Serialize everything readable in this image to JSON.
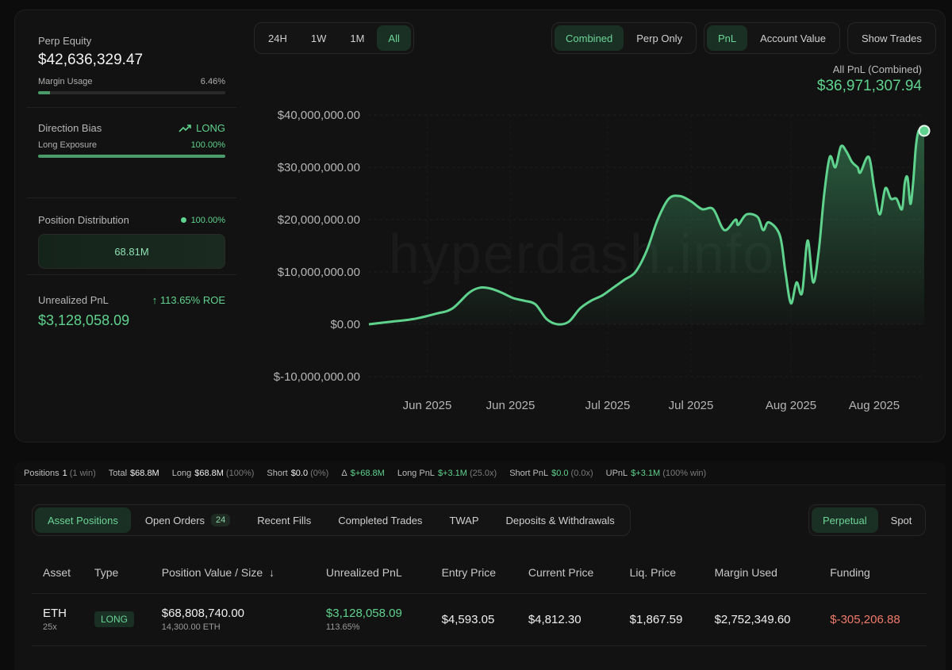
{
  "watermark": "hyperdash.info",
  "left": {
    "perp_equity_label": "Perp Equity",
    "perp_equity_value": "$42,636,329.47",
    "margin_usage_label": "Margin Usage",
    "margin_usage_value": "6.46%",
    "margin_usage_fraction": 0.0646,
    "direction_bias_label": "Direction Bias",
    "direction_bias_value": "LONG",
    "long_exposure_label": "Long Exposure",
    "long_exposure_value": "100.00%",
    "long_exposure_fraction": 1.0,
    "position_distribution_label": "Position Distribution",
    "position_distribution_value": "100.00%",
    "position_distribution_amount": "68.81M",
    "unrealized_pnl_label": "Unrealized PnL",
    "unrealized_pnl_roe": "113.65% ROE",
    "unrealized_pnl_value": "$3,128,058.09"
  },
  "timeframes": [
    "24H",
    "1W",
    "1M",
    "All"
  ],
  "timeframe_active": "All",
  "modes": [
    "Combined",
    "Perp Only"
  ],
  "mode_active": "Combined",
  "metrics": [
    "PnL",
    "Account Value"
  ],
  "metric_active": "PnL",
  "show_trades_label": "Show Trades",
  "pnl_header_label": "All PnL (Combined)",
  "pnl_header_value": "$36,971,307.94",
  "chart_data": {
    "type": "area",
    "ylim": [
      -10000000,
      40000000
    ],
    "y_ticks": [
      40000000,
      30000000,
      20000000,
      10000000,
      0,
      -10000000
    ],
    "y_tick_labels": [
      "$40,000,000.00",
      "$30,000,000.00",
      "$20,000,000.00",
      "$10,000,000.00",
      "$0.00",
      "$-10,000,000.00"
    ],
    "x_tick_labels": [
      "Jun 2025",
      "Jun 2025",
      "Jul 2025",
      "Jul 2025",
      "Aug 2025",
      "Aug 2025"
    ],
    "x_tick_positions": [
      0.105,
      0.255,
      0.43,
      0.58,
      0.76,
      0.91
    ],
    "series": [
      {
        "x": [
          0,
          0.04,
          0.08,
          0.12,
          0.15,
          0.18,
          0.2,
          0.22,
          0.24,
          0.26,
          0.28,
          0.3,
          0.32,
          0.34,
          0.36,
          0.38,
          0.4,
          0.42,
          0.44,
          0.46,
          0.48,
          0.5,
          0.52,
          0.54,
          0.56,
          0.58,
          0.6,
          0.62,
          0.64,
          0.66,
          0.665,
          0.68,
          0.7,
          0.71,
          0.72,
          0.74,
          0.75,
          0.76,
          0.77,
          0.78,
          0.79,
          0.8,
          0.81,
          0.82,
          0.83,
          0.84,
          0.85,
          0.86,
          0.87,
          0.88,
          0.885,
          0.9,
          0.91,
          0.92,
          0.93,
          0.94,
          0.95,
          0.96,
          0.965,
          0.97,
          0.975,
          0.98,
          0.985,
          0.99,
          0.995,
          1.0
        ],
        "y": [
          0,
          500000,
          1000000,
          2000000,
          3000000,
          6000000,
          7000000,
          6800000,
          6000000,
          5000000,
          4500000,
          3800000,
          1000000,
          0,
          500000,
          3000000,
          4500000,
          5500000,
          7000000,
          8500000,
          10000000,
          14000000,
          20000000,
          24000000,
          24500000,
          23500000,
          22000000,
          22000000,
          18000000,
          20000000,
          19000000,
          21000000,
          20500000,
          18000000,
          19500000,
          17000000,
          10000000,
          4000000,
          8000000,
          6000000,
          16000000,
          8000000,
          14000000,
          25000000,
          32000000,
          30000000,
          34000000,
          33000000,
          31000000,
          30000000,
          29000000,
          32000000,
          26000000,
          21000000,
          26000000,
          24000000,
          24000000,
          22000000,
          27000000,
          28000000,
          23000000,
          27000000,
          34000000,
          37000000,
          36500000,
          36971307.94
        ]
      }
    ]
  },
  "stats": {
    "positions_label": "Positions",
    "positions_value": "1",
    "positions_sub": "(1 win)",
    "total_label": "Total",
    "total_value": "$68.8M",
    "long_label": "Long",
    "long_value": "$68.8M",
    "long_sub": "(100%)",
    "short_label": "Short",
    "short_value": "$0.0",
    "short_sub": "(0%)",
    "delta_label": "Δ",
    "delta_value": "$+68.8M",
    "long_pnl_label": "Long PnL",
    "long_pnl_value": "$+3.1M",
    "long_pnl_sub": "(25.0x)",
    "short_pnl_label": "Short PnL",
    "short_pnl_value": "$0.0",
    "short_pnl_sub": "(0.0x)",
    "upnl_label": "UPnL",
    "upnl_value": "$+3.1M",
    "upnl_sub": "(100% win)"
  },
  "tabs": [
    {
      "label": "Asset Positions",
      "active": true
    },
    {
      "label": "Open Orders",
      "badge": "24"
    },
    {
      "label": "Recent Fills"
    },
    {
      "label": "Completed Trades"
    },
    {
      "label": "TWAP"
    },
    {
      "label": "Deposits & Withdrawals"
    }
  ],
  "market_types": [
    "Perpetual",
    "Spot"
  ],
  "market_active": "Perpetual",
  "table": {
    "headers": [
      "Asset",
      "Type",
      "Position Value / Size",
      "Unrealized PnL",
      "Entry Price",
      "Current Price",
      "Liq. Price",
      "Margin Used",
      "Funding"
    ],
    "row": {
      "asset": "ETH",
      "leverage": "25x",
      "type": "LONG",
      "position_value": "$68,808,740.00",
      "position_size": "14,300.00 ETH",
      "unrealized_pnl": "$3,128,058.09",
      "unrealized_pnl_pct": "113.65%",
      "entry_price": "$4,593.05",
      "current_price": "$4,812.30",
      "liq_price": "$1,867.59",
      "margin_used": "$2,752,349.60",
      "funding": "$-305,206.88"
    }
  }
}
